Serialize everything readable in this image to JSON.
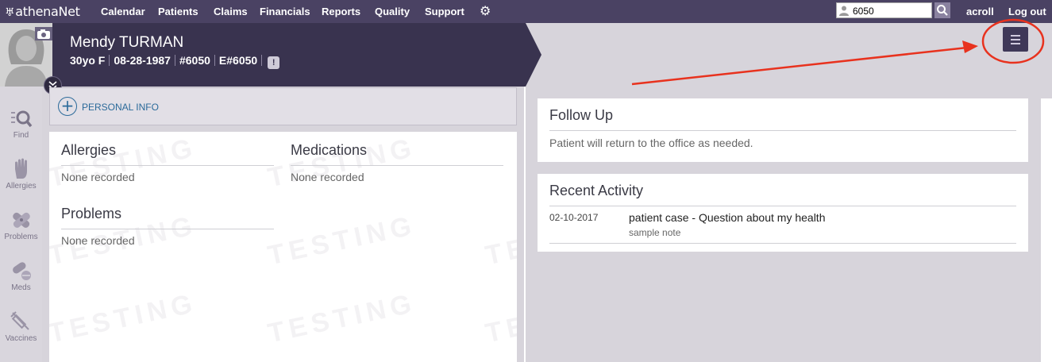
{
  "nav": {
    "logo": "athenaNet",
    "items": [
      "Calendar",
      "Patients",
      "Claims",
      "Financials",
      "Reports",
      "Quality",
      "Support"
    ],
    "search_value": "6050",
    "user": "acroll",
    "logout": "Log out"
  },
  "patient": {
    "name": "Mendy TURMAN",
    "age_sex": "30yo F",
    "dob": "08-28-1987",
    "id": "#6050",
    "enterprise_id": "E#6050",
    "alert": "!"
  },
  "sidebar": {
    "items": [
      "Find",
      "Allergies",
      "Problems",
      "Meds",
      "Vaccines"
    ]
  },
  "personal_info": {
    "label": "PERSONAL INFO"
  },
  "summary": {
    "allergies": {
      "title": "Allergies",
      "value": "None recorded"
    },
    "medications": {
      "title": "Medications",
      "value": "None recorded"
    },
    "problems": {
      "title": "Problems",
      "value": "None recorded"
    },
    "watermark": "TESTING"
  },
  "follow_up": {
    "title": "Follow Up",
    "text": "Patient will return to the office as needed."
  },
  "recent_activity": {
    "title": "Recent Activity",
    "entries": [
      {
        "date": "02-10-2017",
        "title": "patient case - Question about my health",
        "note": "sample note"
      }
    ]
  },
  "colors": {
    "nav_bg": "#4a4263",
    "banner_bg": "#39334f",
    "accent_link": "#2b6a9a",
    "annotation": "#e8321e"
  }
}
